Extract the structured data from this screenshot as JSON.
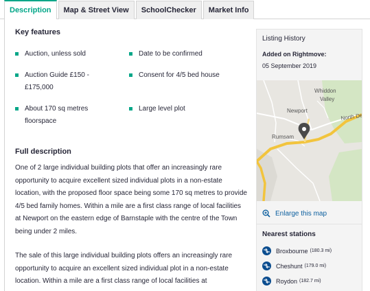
{
  "tabs": [
    {
      "label": "Description",
      "active": true
    },
    {
      "label": "Map & Street View",
      "active": false
    },
    {
      "label": "SchoolChecker",
      "active": false
    },
    {
      "label": "Market Info",
      "active": false
    }
  ],
  "key_features": {
    "title": "Key features",
    "items": [
      "Auction, unless sold",
      "Date to be confirmed",
      "Auction Guide £150 - £175,000",
      "Consent for 4/5 bed house",
      "About 170 sq metres floorspace",
      "Large level plot"
    ]
  },
  "full_description": {
    "title": "Full description",
    "paragraphs": [
      "One of 2 large individual building plots that offer an increasingly rare opportunity to acquire excellent sized individual plots in a non-estate location, with the proposed floor space being some 170 sq metres to provide 4/5 bed family homes. Within a mile are a first class range of local facilities at Newport on the eastern edge of Barnstaple with the centre of the Town being under 2 miles.",
      "The sale of this large individual building plots offers an increasingly rare opportunity to acquire an excellent sized individual plot in a non-estate location. Within a mile are a first class range of local facilities at"
    ]
  },
  "listing_history": {
    "title": "Listing History",
    "added_label": "Added on Rightmove:",
    "added_date": "05 September 2019"
  },
  "map": {
    "labels": {
      "whiddon": "Whiddon",
      "valley": "Valley",
      "newport": "Newport",
      "north_devon": "North De",
      "rumsam": "Rumsam"
    },
    "enlarge_label": "Enlarge this map"
  },
  "nearest_stations": {
    "title": "Nearest stations",
    "stations": [
      {
        "name": "Broxbourne",
        "distance": "(180.3 mi)"
      },
      {
        "name": "Cheshunt",
        "distance": "(179.0 mi)"
      },
      {
        "name": "Roydon",
        "distance": "(182.7 mi)"
      }
    ]
  },
  "colors": {
    "accent": "#00a688",
    "link": "#0b5e9e",
    "rail": "#0b4d8f",
    "road": "#f2c43d",
    "pin": "#4a4a4a"
  }
}
